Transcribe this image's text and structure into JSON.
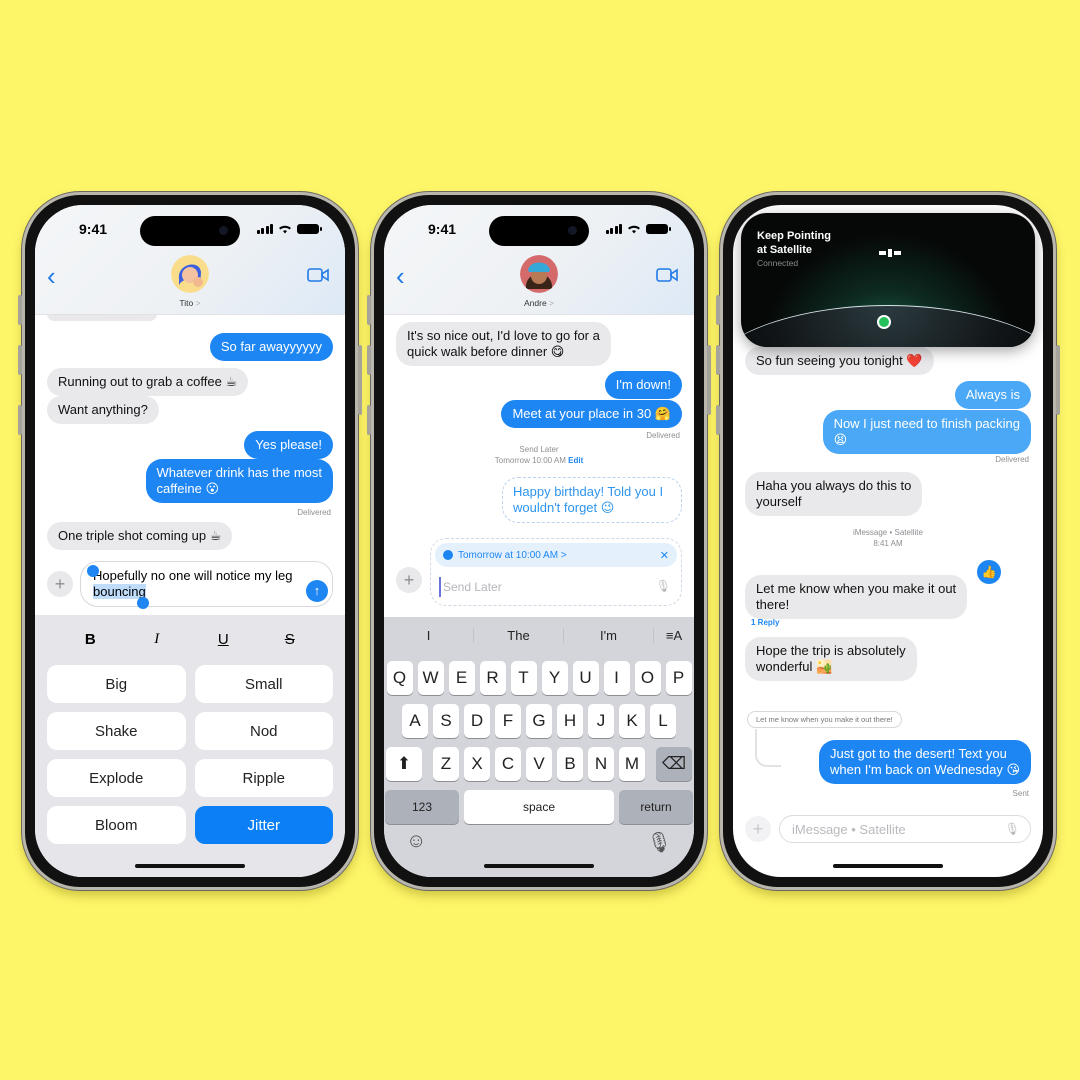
{
  "colors": {
    "background": "#fef669",
    "imessage_blue": "#1d86f3",
    "incoming_gray": "#e9e9eb"
  },
  "phone1": {
    "status_time": "9:41",
    "contact_name": "Tito",
    "contact_chevron": ">",
    "back_icon": "chevron-left-icon",
    "video_icon": "video-camera-icon",
    "messages": [
      {
        "dir": "out",
        "text": "So far awayyyyyy"
      },
      {
        "dir": "in",
        "text": "Running out to grab a coffee ☕"
      },
      {
        "dir": "in",
        "text": "Want anything?"
      },
      {
        "dir": "out",
        "text": "Yes please!"
      },
      {
        "dir": "out",
        "text_line1": "Whatever drink has the most",
        "text_line2": "caffeine 😮"
      },
      {
        "dir": "in",
        "text": "One triple shot coming up ☕"
      }
    ],
    "delivered": "Delivered",
    "compose": {
      "line1": "Hopefully no one will notice my leg",
      "selected_word": "bouncing"
    },
    "format_buttons": {
      "bold": "B",
      "italic": "I",
      "underline": "U",
      "strike": "S"
    },
    "effects": [
      "Big",
      "Small",
      "Shake",
      "Nod",
      "Explode",
      "Ripple",
      "Bloom",
      "Jitter"
    ],
    "selected_effect": "Jitter"
  },
  "phone2": {
    "status_time": "9:41",
    "contact_name": "Andre",
    "contact_chevron": ">",
    "messages": [
      {
        "dir": "in",
        "text_line1": "It's so nice out, I'd love to go for a",
        "text_line2": "quick walk before dinner 😋"
      },
      {
        "dir": "out",
        "text": "I'm down!"
      },
      {
        "dir": "out",
        "text": "Meet at your place in 30 🤗"
      }
    ],
    "delivered": "Delivered",
    "send_later_label": "Send Later",
    "send_later_time": "Tomorrow 10:00 AM",
    "edit_link": "Edit",
    "scheduled_message": {
      "line1": "Happy birthday! Told you I",
      "line2": "wouldn't forget 😉"
    },
    "schedule_pill": "Tomorrow at 10:00 AM >",
    "input_placeholder": "Send Later",
    "suggestions": [
      "I",
      "The",
      "I'm",
      "≡A"
    ],
    "keyboard_rows": [
      [
        "Q",
        "W",
        "E",
        "R",
        "T",
        "Y",
        "U",
        "I",
        "O",
        "P"
      ],
      [
        "A",
        "S",
        "D",
        "F",
        "G",
        "H",
        "J",
        "K",
        "L"
      ],
      [
        "Z",
        "X",
        "C",
        "V",
        "B",
        "N",
        "M"
      ]
    ],
    "keys": {
      "numbers": "123",
      "space": "space",
      "return": "return"
    }
  },
  "phone3": {
    "satellite_title_line1": "Keep Pointing",
    "satellite_title_line2": "at Satellite",
    "satellite_status": "Connected",
    "messages": [
      {
        "dir": "in",
        "text": "So fun seeing you tonight ❤️"
      },
      {
        "dir": "out",
        "text": "Always is"
      },
      {
        "dir": "out",
        "text_line1": "Now I just need to finish packing",
        "text_line2": "😫"
      },
      {
        "dir": "in",
        "text_line1": "Haha you always do this to",
        "text_line2": "yourself"
      },
      {
        "dir": "in",
        "text_line1": "Let me know when you make it out",
        "text_line2": "there!"
      },
      {
        "dir": "in",
        "text_line1": "Hope the trip is absolutely",
        "text_line2": "wonderful 🏜️"
      },
      {
        "dir": "out",
        "text_line1": "Just got to the desert! Text you",
        "text_line2": "when I'm back on Wednesday 😘"
      }
    ],
    "delivered": "Delivered",
    "service_label": "iMessage • Satellite",
    "service_time": "8:41 AM",
    "tapback": "👍",
    "reply_count": "1 Reply",
    "reply_preview": "Let me know when you make it out there!",
    "sent": "Sent",
    "input_placeholder": "iMessage • Satellite"
  }
}
